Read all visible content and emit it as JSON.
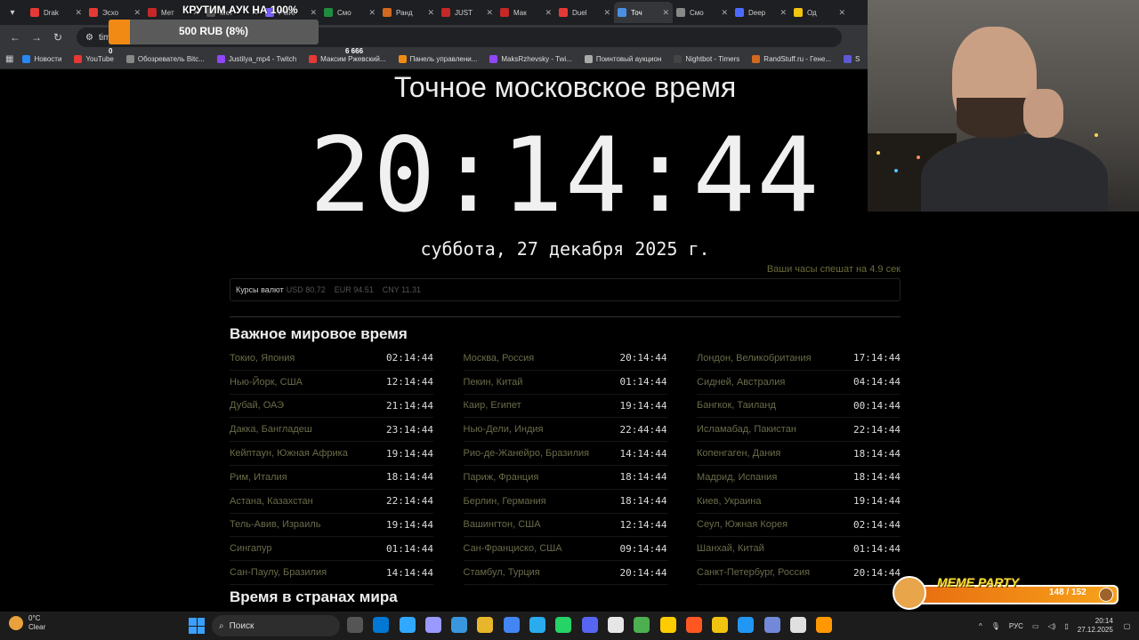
{
  "browser": {
    "tabs": [
      {
        "label": "Drak",
        "color": "#e53935"
      },
      {
        "label": "Эсхо",
        "color": "#e53935"
      },
      {
        "label": "Мет",
        "color": "#c62828"
      },
      {
        "label": "Мет",
        "color": "#555555"
      },
      {
        "label": "Point",
        "color": "#7b61ff"
      },
      {
        "label": "Смо",
        "color": "#1e8e3e"
      },
      {
        "label": "Ранд",
        "color": "#d2691e"
      },
      {
        "label": "JUST",
        "color": "#c62828"
      },
      {
        "label": "Мак",
        "color": "#c62828"
      },
      {
        "label": "Duel",
        "color": "#e53935"
      },
      {
        "label": "Точ",
        "color": "#4a90e2",
        "active": true
      },
      {
        "label": "Смо",
        "color": "#888888"
      },
      {
        "label": "Deep",
        "color": "#4b6bff"
      },
      {
        "label": "Од",
        "color": "#f1c40f"
      }
    ],
    "url": "time",
    "bookmarks": [
      {
        "label": "Новости",
        "color": "#2787f5"
      },
      {
        "label": "YouTube",
        "color": "#e53935"
      },
      {
        "label": "Обозреватель Bitc...",
        "color": "#888888"
      },
      {
        "label": "Justilya_mp4 - Twitch",
        "color": "#9146ff"
      },
      {
        "label": "Максим Ржевский...",
        "color": "#e53935"
      },
      {
        "label": "Панель управлени...",
        "color": "#f08a14"
      },
      {
        "label": "MaksRzhevsky - Twi...",
        "color": "#9146ff"
      },
      {
        "label": "Поинтовый аукцион",
        "color": "#aaaaaa"
      },
      {
        "label": "Nightbot - Timers",
        "color": "#444444"
      },
      {
        "label": "RandStuff.ru - Гене...",
        "color": "#d2691e"
      },
      {
        "label": "S",
        "color": "#5b5bd6"
      }
    ]
  },
  "auction": {
    "title": "КРУТИМ АУК НА 100%",
    "amount": "500 RUB (8%)",
    "progress": 0.1,
    "min": "0",
    "max": "6 666"
  },
  "page": {
    "title": "Точное московское время",
    "clock": "20:14:44",
    "date": "суббота, 27 декабря 2025 г.",
    "drift": "Ваши часы спешат на 4.9 сек",
    "rates_label": "Курсы валют",
    "rates": [
      "USD 80.72",
      "EUR 94.51",
      "CNY 11.31"
    ],
    "section_world": "Важное мировое время",
    "section_countries": "Время в странах мира",
    "columns": [
      [
        {
          "city": "Токио, Япония",
          "time": "02:14:44"
        },
        {
          "city": "Нью-Йорк, США",
          "time": "12:14:44"
        },
        {
          "city": "Дубай, ОАЭ",
          "time": "21:14:44"
        },
        {
          "city": "Дакка, Бангладеш",
          "time": "23:14:44"
        },
        {
          "city": "Кейптаун, Южная Африка",
          "time": "19:14:44"
        },
        {
          "city": "Рим, Италия",
          "time": "18:14:44"
        },
        {
          "city": "Астана, Казахстан",
          "time": "22:14:44"
        },
        {
          "city": "Тель-Авив, Израиль",
          "time": "19:14:44"
        },
        {
          "city": "Сингапур",
          "time": "01:14:44"
        },
        {
          "city": "Сан-Паулу, Бразилия",
          "time": "14:14:44"
        }
      ],
      [
        {
          "city": "Москва, Россия",
          "time": "20:14:44"
        },
        {
          "city": "Пекин, Китай",
          "time": "01:14:44"
        },
        {
          "city": "Каир, Египет",
          "time": "19:14:44"
        },
        {
          "city": "Нью-Дели, Индия",
          "time": "22:44:44"
        },
        {
          "city": "Рио-де-Жанейро, Бразилия",
          "time": "14:14:44"
        },
        {
          "city": "Париж, Франция",
          "time": "18:14:44"
        },
        {
          "city": "Берлин, Германия",
          "time": "18:14:44"
        },
        {
          "city": "Вашингтон, США",
          "time": "12:14:44"
        },
        {
          "city": "Сан-Франциско, США",
          "time": "09:14:44"
        },
        {
          "city": "Стамбул, Турция",
          "time": "20:14:44"
        }
      ],
      [
        {
          "city": "Лондон, Великобритания",
          "time": "17:14:44"
        },
        {
          "city": "Сидней, Австралия",
          "time": "04:14:44"
        },
        {
          "city": "Бангкок, Таиланд",
          "time": "00:14:44"
        },
        {
          "city": "Исламабад, Пакистан",
          "time": "22:14:44"
        },
        {
          "city": "Копенгаген, Дания",
          "time": "18:14:44"
        },
        {
          "city": "Мадрид, Испания",
          "time": "18:14:44"
        },
        {
          "city": "Киев, Украина",
          "time": "19:14:44"
        },
        {
          "city": "Сеул, Южная Корея",
          "time": "02:14:44"
        },
        {
          "city": "Шанхай, Китай",
          "time": "01:14:44"
        },
        {
          "city": "Санкт-Петербург, Россия",
          "time": "20:14:44"
        }
      ]
    ]
  },
  "meme_party": {
    "title": "MEME PARTY",
    "count": "148 / 152"
  },
  "taskbar": {
    "weather_temp": "0°C",
    "weather_desc": "Clear",
    "search_placeholder": "Поиск",
    "apps": [
      "#555555",
      "#0078d4",
      "#31a8ff",
      "#9999ff",
      "#3a96dd",
      "#e8b62a",
      "#4285f4",
      "#2aabee",
      "#25d366",
      "#5865f2",
      "#e6e6e6",
      "#4caf50",
      "#ffcc00",
      "#ff5722",
      "#f1c40f",
      "#2196f3",
      "#7289da",
      "#e0e0e0",
      "#ff9800"
    ],
    "lang": "РУС",
    "time": "20:14",
    "date": "27.12.2025"
  }
}
